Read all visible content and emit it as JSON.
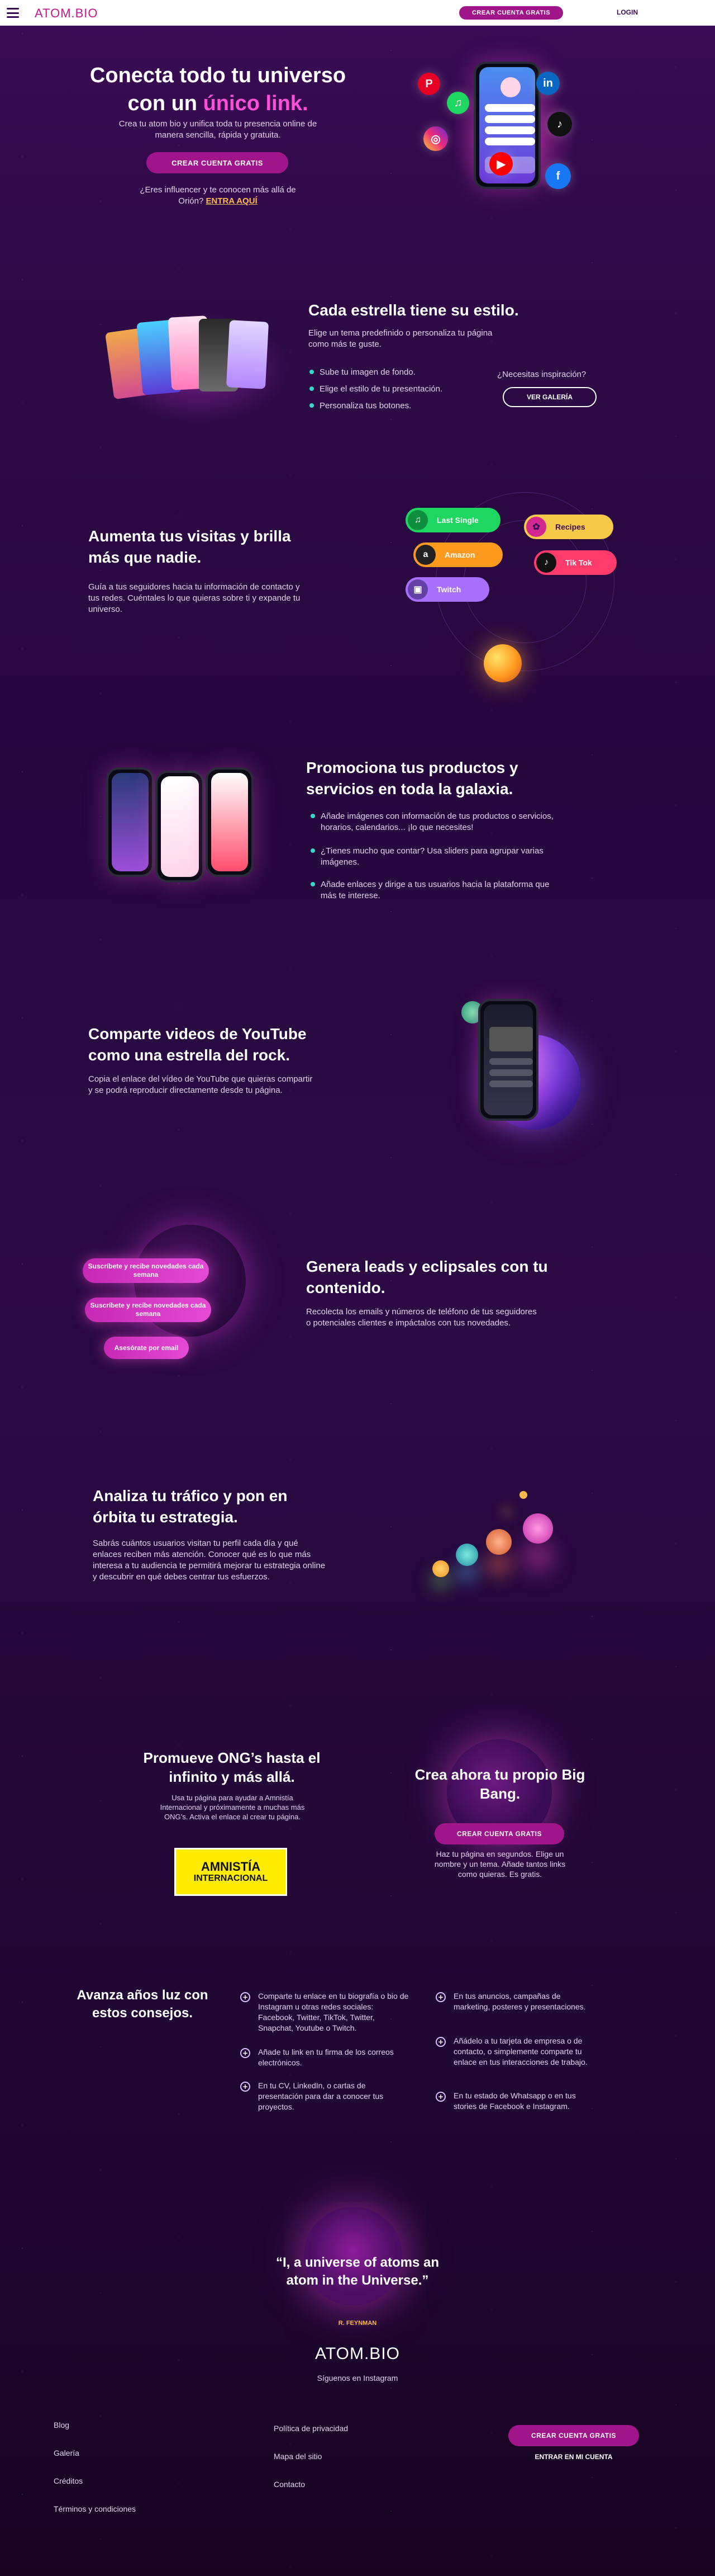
{
  "header": {
    "logo": "ATOM.BIO",
    "cta_label": "CREAR CUENTA GRATIS",
    "login_label": "LOGIN"
  },
  "hero": {
    "title_line1": "Conecta todo tu universo",
    "title_line2_prefix": "con un ",
    "title_line2_highlight": "único link.",
    "subtitle": "Crea tu atom bio y unifica toda tu presencia online de manera sencilla, rápida y gratuita.",
    "cta_label": "CREAR CUENTA GRATIS",
    "influencer_text": "¿Eres influencer y te conocen más allá de Orión?",
    "influencer_link": "ENTRA AQUÍ"
  },
  "styles_section": {
    "title": "Cada estrella tiene su estilo.",
    "intro": "Elige un tema predefinido o personaliza tu página como más te guste.",
    "bullets": [
      "Sube tu imagen de fondo.",
      "Elige el estilo de tu presentación.",
      "Personaliza tus botones."
    ],
    "inspiration_text": "¿Necesitas inspiración?",
    "gallery_button": "VER GALERÍA"
  },
  "visits_section": {
    "title": "Aumenta tus visitas y brilla más que nadie.",
    "body": "Guía a tus seguidores hacia tu información de contacto y tus redes. Cuéntales lo que quieras sobre ti y expande tu universo.",
    "buttons": [
      {
        "label": "Last Single",
        "icon": "spotify-icon",
        "color": "#1ed760"
      },
      {
        "label": "Recipes",
        "icon": "food-icon",
        "color": "#f7c948"
      },
      {
        "label": "Amazon",
        "icon": "amazon-icon",
        "color": "#ff9a1f"
      },
      {
        "label": "Tik Tok",
        "icon": "tiktok-icon",
        "color": "#ff3b6b"
      },
      {
        "label": "Twitch",
        "icon": "twitch-icon",
        "color": "#a970ff"
      }
    ]
  },
  "products_section": {
    "title": "Promociona tus productos y servicios en toda la galaxia.",
    "bullets": [
      "Añade imágenes con información de tus productos o servicios, horarios, calendarios... ¡lo que necesites!",
      "¿Tienes mucho que contar? Usa sliders para agrupar varias imágenes.",
      "Añade enlaces y dirige a tus usuarios hacia la plataforma que más te interese."
    ]
  },
  "youtube_section": {
    "title": "Comparte videos de YouTube como una estrella del rock.",
    "body": "Copia el enlace del vídeo de YouTube que quieras compartir y se podrá reproducir directamente desde tu página."
  },
  "leads_section": {
    "title": "Genera leads y eclipsales con tu contenido.",
    "body": "Recolecta los emails y números de teléfono de tus seguidores o potenciales clientes e impáctalos con tus novedades.",
    "pills": [
      "Suscríbete y recibe novedades cada semana",
      "Suscríbete y recibe novedades cada semana",
      "Asesórate por email"
    ]
  },
  "traffic_section": {
    "title": "Analiza tu tráfico y pon en órbita tu estrategia.",
    "body": "Sabrás cuántos usuarios visitan tu perfil cada día y qué enlaces reciben más atención. Conocer qué es lo que más interesa a tu audiencia te permitirá mejorar tu estrategia online y descubrir en qué debes centrar tus esfuerzos."
  },
  "ong_section": {
    "title": "Promueve ONG’s hasta el infinito y más allá.",
    "body": "Usa tu página para ayudar a Amnistía Internacional y próximamente a muchas más ONG’s. Activa el enlace al crear tu página.",
    "logo_line1": "AMNISTÍA",
    "logo_line2": "INTERNACIONAL"
  },
  "bigbang_section": {
    "title": "Crea ahora tu propio Big Bang.",
    "cta_label": "CREAR CUENTA GRATIS",
    "body": "Haz tu página en segundos. Elige un nombre y un tema. Añade tantos links como quieras. Es gratis."
  },
  "tips_section": {
    "title": "Avanza años luz con estos consejos.",
    "tips_left": [
      "Comparte tu enlace en tu biografía o bio de Instagram u otras redes sociales: Facebook, Twitter, TikTok, Twitter, Snapchat, Youtube o Twitch.",
      "Añade tu link en tu firma de los correos electrónicos.",
      "En tu CV, LinkedIn, o cartas de presentación para dar a conocer tus proyectos."
    ],
    "tips_right": [
      "En tus anuncios, campañas de marketing, posteres y presentaciones.",
      "Añádelo a tu tarjeta de empresa o de contacto, o simplemente comparte tu enlace en tus interacciones de trabajo.",
      "En tu estado de Whatsapp o en tus stories de Facebook e Instagram."
    ]
  },
  "quote_section": {
    "quote": "“I, a universe of atoms an atom in the Universe.”",
    "author": "R. FEYNMAN",
    "logo": "ATOM.BIO",
    "follow_text": "Síguenos en Instagram"
  },
  "footer": {
    "col1": [
      "Blog",
      "Galería",
      "Créditos",
      "Términos y condiciones"
    ],
    "col2": [
      "Política de privacidad",
      "Mapa del sitio",
      "Contacto"
    ],
    "cta_label": "CREAR CUENTA GRATIS",
    "login_label": "ENTRAR EN MI CUENTA"
  }
}
